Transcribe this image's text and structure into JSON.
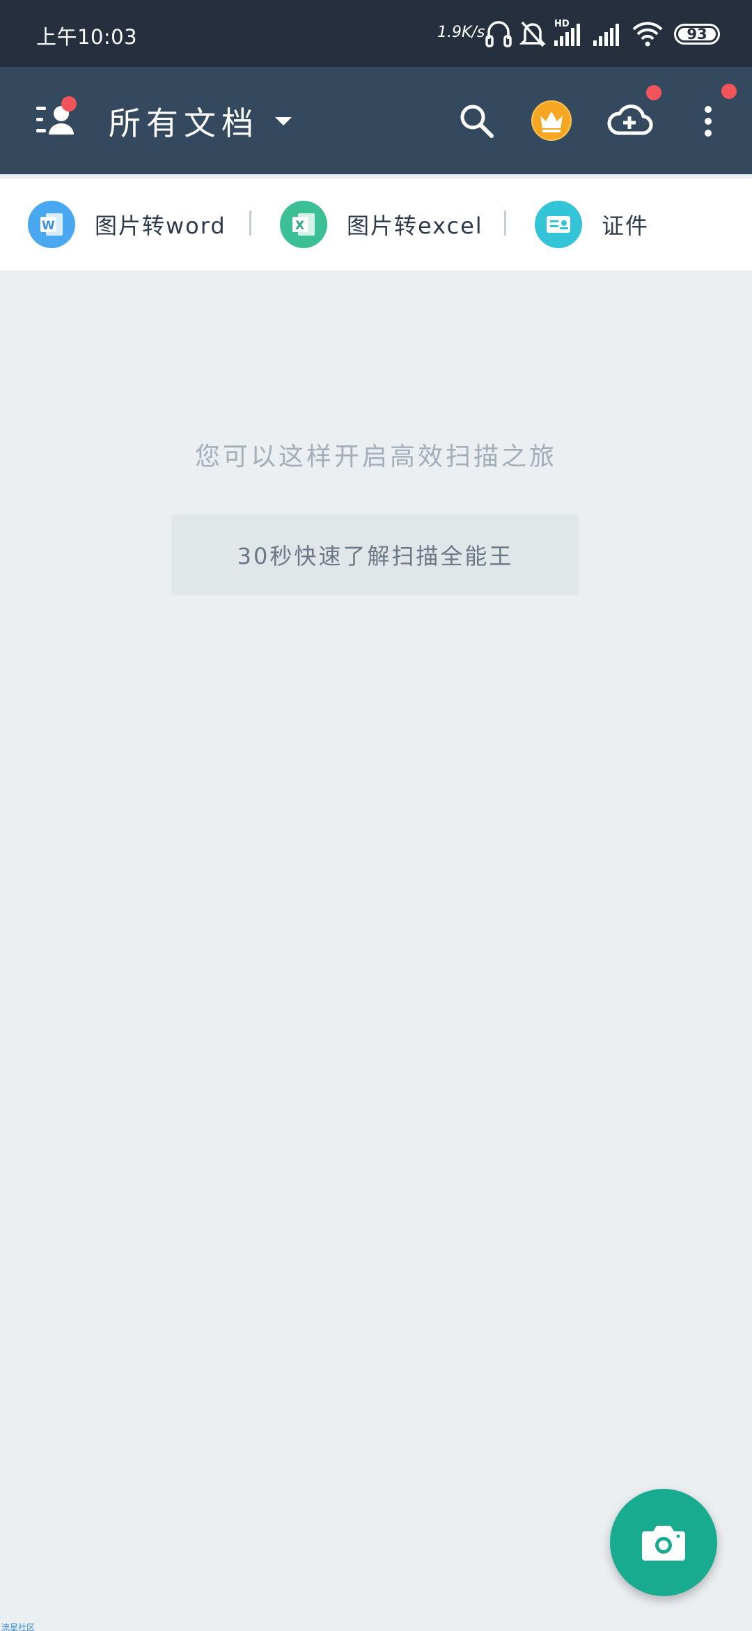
{
  "status_bar": {
    "time": "上午10:03",
    "net_speed": "1.9K/s",
    "battery": "93",
    "icons": [
      "headset-icon",
      "bell-muted-icon",
      "hd-signal-icon",
      "signal-icon",
      "wifi-icon",
      "battery-icon"
    ]
  },
  "app_bar": {
    "title": "所有文档",
    "icons": [
      "profile-menu-icon",
      "chevron-down-icon",
      "search-icon",
      "crown-icon",
      "cloud-upload-icon",
      "more-vert-icon"
    ],
    "badge_color": "#f2545b"
  },
  "tools": [
    {
      "label": "图片转word",
      "icon": "word-icon",
      "color": "#4aa8f0"
    },
    {
      "label": "图片转excel",
      "icon": "excel-icon",
      "color": "#3cbf95"
    },
    {
      "label": "证件",
      "icon": "id-card-icon",
      "color": "#33c4d8"
    }
  ],
  "empty_state": {
    "hint": "您可以这样开启高效扫描之旅",
    "button": "30秒快速了解扫描全能王"
  },
  "fab": {
    "icon": "camera-icon",
    "color": "#19ab8f"
  },
  "watermark": "流星社区"
}
